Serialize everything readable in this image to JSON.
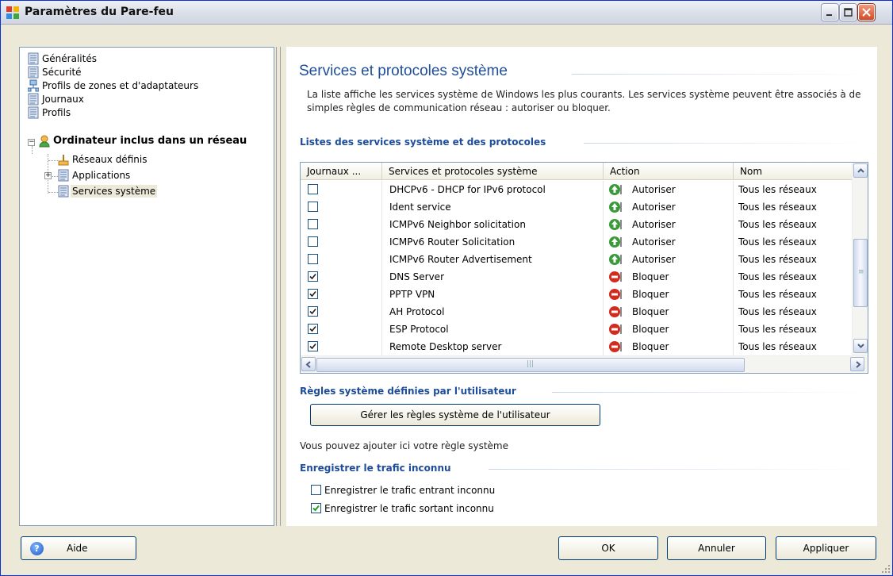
{
  "window": {
    "title": "Paramètres du Pare-feu"
  },
  "tree": {
    "items": [
      {
        "label": "Généralités"
      },
      {
        "label": "Sécurité"
      },
      {
        "label": "Profils de zones et d'adaptateurs"
      },
      {
        "label": "Journaux"
      },
      {
        "label": "Profils"
      },
      {
        "label": "Ordinateur inclus dans un réseau"
      },
      {
        "label": "Réseaux définis"
      },
      {
        "label": "Applications"
      },
      {
        "label": "Services système"
      }
    ],
    "selected": "Services système"
  },
  "content": {
    "title": "Services et protocoles système",
    "description": "La liste affiche les services système de Windows les plus courants. Les services système peuvent être associés à de simples règles de communication réseau : autoriser ou bloquer.",
    "list_section": "Listes des services système et des protocoles",
    "user_rules_section": "Règles système définies par l'utilisateur",
    "manage_button": "Gérer les règles système de l'utilisateur",
    "user_rules_hint": "Vous pouvez ajouter ici votre règle système",
    "unknown_section": "Enregistrer le trafic inconnu",
    "incoming_label": "Enregistrer le trafic entrant inconnu",
    "incoming_checked": false,
    "outgoing_label": "Enregistrer le trafic sortant inconnu",
    "outgoing_checked": true
  },
  "grid": {
    "columns": [
      "Journaux ...",
      "Services et protocoles système",
      "Action",
      "Nom"
    ],
    "rows": [
      {
        "log": false,
        "service": "DHCPv6 - DHCP for IPv6 protocol",
        "action": "Autoriser",
        "name": "Tous les réseaux"
      },
      {
        "log": false,
        "service": "Ident service",
        "action": "Autoriser",
        "name": "Tous les réseaux"
      },
      {
        "log": false,
        "service": "ICMPv6 Neighbor solicitation",
        "action": "Autoriser",
        "name": "Tous les réseaux"
      },
      {
        "log": false,
        "service": "ICMPv6 Router Solicitation",
        "action": "Autoriser",
        "name": "Tous les réseaux"
      },
      {
        "log": false,
        "service": "ICMPv6 Router Advertisement",
        "action": "Autoriser",
        "name": "Tous les réseaux"
      },
      {
        "log": true,
        "service": "DNS Server",
        "action": "Bloquer",
        "name": "Tous les réseaux"
      },
      {
        "log": true,
        "service": "PPTP VPN",
        "action": "Bloquer",
        "name": "Tous les réseaux"
      },
      {
        "log": true,
        "service": "AH Protocol",
        "action": "Bloquer",
        "name": "Tous les réseaux"
      },
      {
        "log": true,
        "service": "ESP Protocol",
        "action": "Bloquer",
        "name": "Tous les réseaux"
      },
      {
        "log": true,
        "service": "Remote Desktop server",
        "action": "Bloquer",
        "name": "Tous les réseaux"
      }
    ]
  },
  "footer": {
    "help": "Aide",
    "ok": "OK",
    "cancel": "Annuler",
    "apply": "Appliquer"
  },
  "colors": {
    "heading": "#1e4d9b",
    "allow": "#3a9a3a",
    "block": "#d22b1e",
    "window_bg": "#ece9d8"
  }
}
